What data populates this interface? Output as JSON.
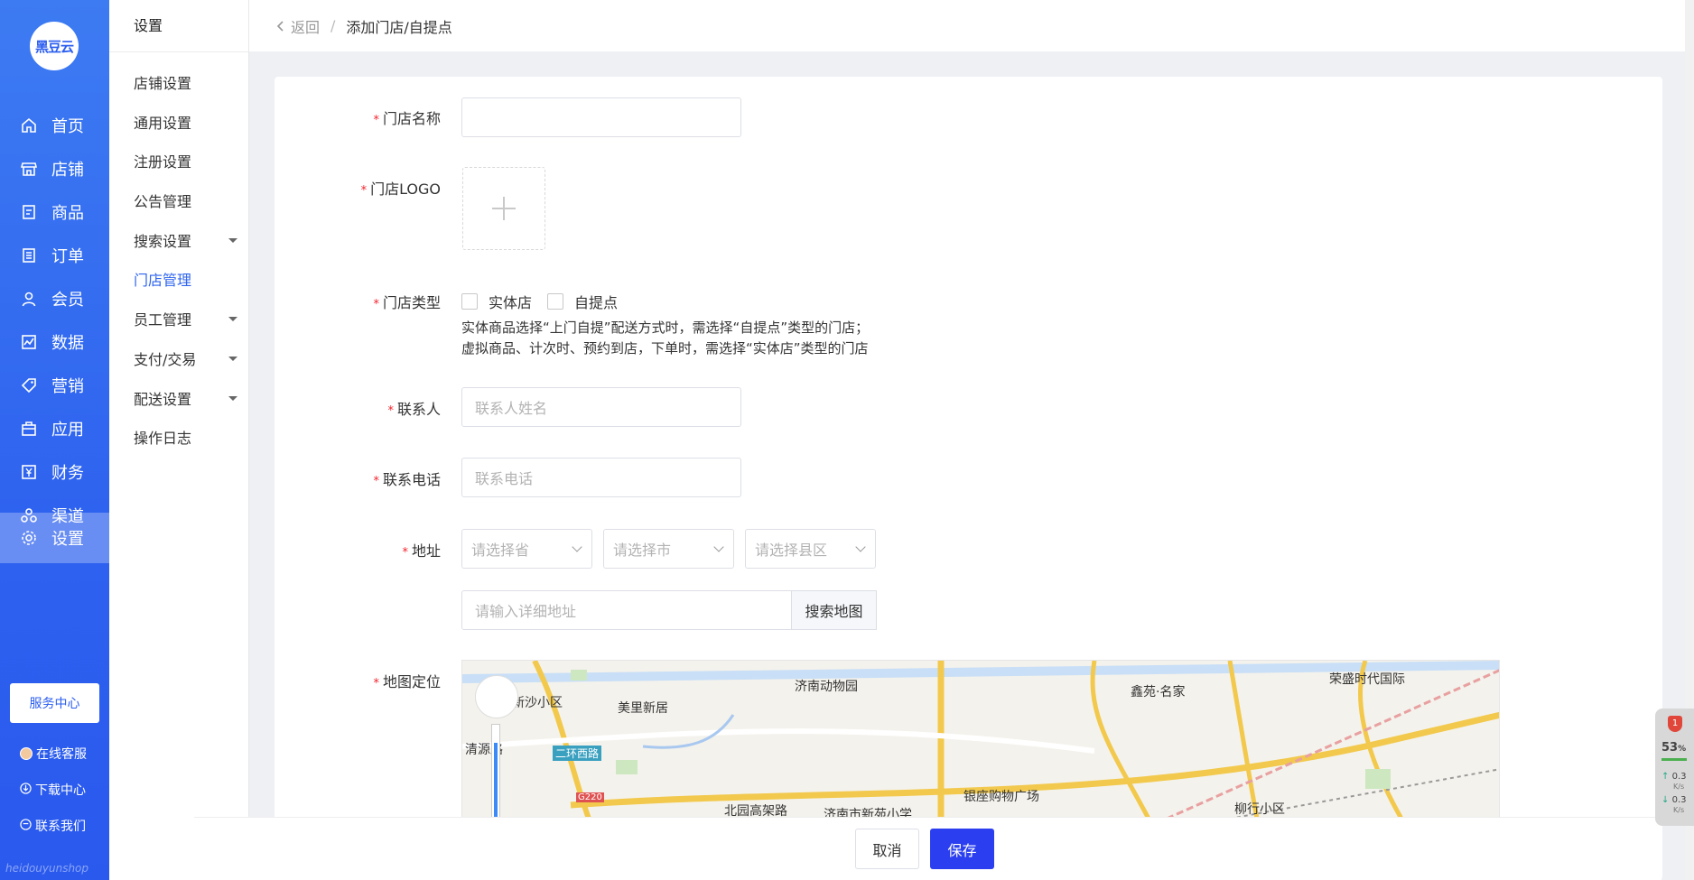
{
  "brand": {
    "logo_text": "黑豆云",
    "watermark": "heidouyunshop"
  },
  "nav": {
    "items": [
      {
        "label": "首页",
        "icon": "home-icon"
      },
      {
        "label": "店铺",
        "icon": "store-icon"
      },
      {
        "label": "商品",
        "icon": "goods-icon"
      },
      {
        "label": "订单",
        "icon": "order-icon"
      },
      {
        "label": "会员",
        "icon": "member-icon"
      },
      {
        "label": "数据",
        "icon": "chart-icon"
      },
      {
        "label": "营销",
        "icon": "tag-icon"
      },
      {
        "label": "应用",
        "icon": "app-icon"
      },
      {
        "label": "财务",
        "icon": "finance-icon"
      },
      {
        "label": "渠道",
        "icon": "channel-icon"
      },
      {
        "label": "设置",
        "icon": "gear-icon"
      }
    ],
    "service_center": "服务中心",
    "links": [
      {
        "label": "在线客服",
        "icon": "avatar-icon"
      },
      {
        "label": "下载中心",
        "icon": "download-icon"
      },
      {
        "label": "联系我们",
        "icon": "phone-icon"
      }
    ]
  },
  "submenu": {
    "title": "设置",
    "items": [
      {
        "label": "店铺设置"
      },
      {
        "label": "通用设置"
      },
      {
        "label": "注册设置"
      },
      {
        "label": "公告管理"
      },
      {
        "label": "搜索设置"
      },
      {
        "label": "门店管理"
      },
      {
        "label": "员工管理"
      },
      {
        "label": "支付/交易"
      },
      {
        "label": "配送设置"
      },
      {
        "label": "操作日志"
      }
    ]
  },
  "header": {
    "back": "返回",
    "separator": "/",
    "title": "添加门店/自提点"
  },
  "form": {
    "required_mark": "*",
    "store_name_label": "门店名称",
    "store_name_value": "",
    "logo_label": "门店LOGO",
    "type_label": "门店类型",
    "type_options": [
      "实体店",
      "自提点"
    ],
    "type_hint_1": "实体商品选择“上门自提”配送方式时，需选择“自提点”类型的门店；",
    "type_hint_2": "虚拟商品、计次时、预约到店，下单时，需选择“实体店”类型的门店",
    "contact_label": "联系人",
    "contact_placeholder": "联系人姓名",
    "phone_label": "联系电话",
    "phone_placeholder": "联系电话",
    "address_label": "地址",
    "province_placeholder": "请选择省",
    "city_placeholder": "请选择市",
    "district_placeholder": "请选择县区",
    "detail_placeholder": "请输入详细地址",
    "search_map": "搜索地图",
    "map_label": "地图定位"
  },
  "map": {
    "labels": [
      "新沙小区",
      "美里新居",
      "济南动物园",
      "鑫苑·名家",
      "荣盛时代国际",
      "清源路",
      "二环西路",
      "G220",
      "北园高架路",
      "济南市新苑小学",
      "银座购物广场",
      "柳行小区"
    ]
  },
  "footer": {
    "cancel": "取消",
    "save": "保存"
  },
  "widget": {
    "badge": "1",
    "percent": "53",
    "percent_unit": "%",
    "up": "0.3",
    "down": "0.3",
    "unit": "K/s"
  },
  "colors": {
    "primary": "#2f64ef",
    "nav_bg": "#3d7bf2",
    "save": "#2b3ff0",
    "required": "#f5222d"
  }
}
